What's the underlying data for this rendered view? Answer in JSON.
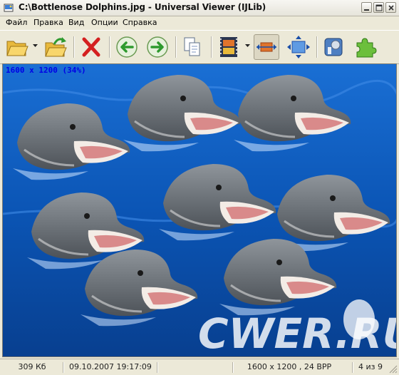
{
  "window": {
    "title": "C:\\Bottlenose Dolphins.jpg - Universal Viewer (IJLib)"
  },
  "menu": {
    "items": [
      "Файл",
      "Правка",
      "Вид",
      "Опции",
      "Справка"
    ]
  },
  "toolbar": {
    "buttons": [
      {
        "icon": "open-folder-icon"
      },
      {
        "icon": "reopen-folder-icon"
      },
      {
        "icon": "delete-icon"
      },
      {
        "icon": "back-arrow-icon"
      },
      {
        "icon": "forward-arrow-icon"
      },
      {
        "icon": "copy-icon"
      },
      {
        "icon": "filmstrip-icon"
      },
      {
        "icon": "fit-width-icon",
        "pressed": true
      },
      {
        "icon": "fit-window-icon"
      },
      {
        "icon": "settings-icon"
      },
      {
        "icon": "plugin-puzzle-icon"
      }
    ]
  },
  "viewer": {
    "image_info": "1600 x 1200 (34%)",
    "zoom_percent": 34,
    "background_color": "#0d55b8",
    "watermark_text": "CWER.RU"
  },
  "status": {
    "file_size": "309 Кб",
    "datetime": "09.10.2007 19:17:09",
    "dimensions": "1600 x 1200 , 24 BPP",
    "position": "4 из 9"
  },
  "colors": {
    "window_bg": "#ece9d8",
    "info_text": "#0000e6",
    "delete_red": "#d42020",
    "arrow_green": "#2e9a2e"
  }
}
